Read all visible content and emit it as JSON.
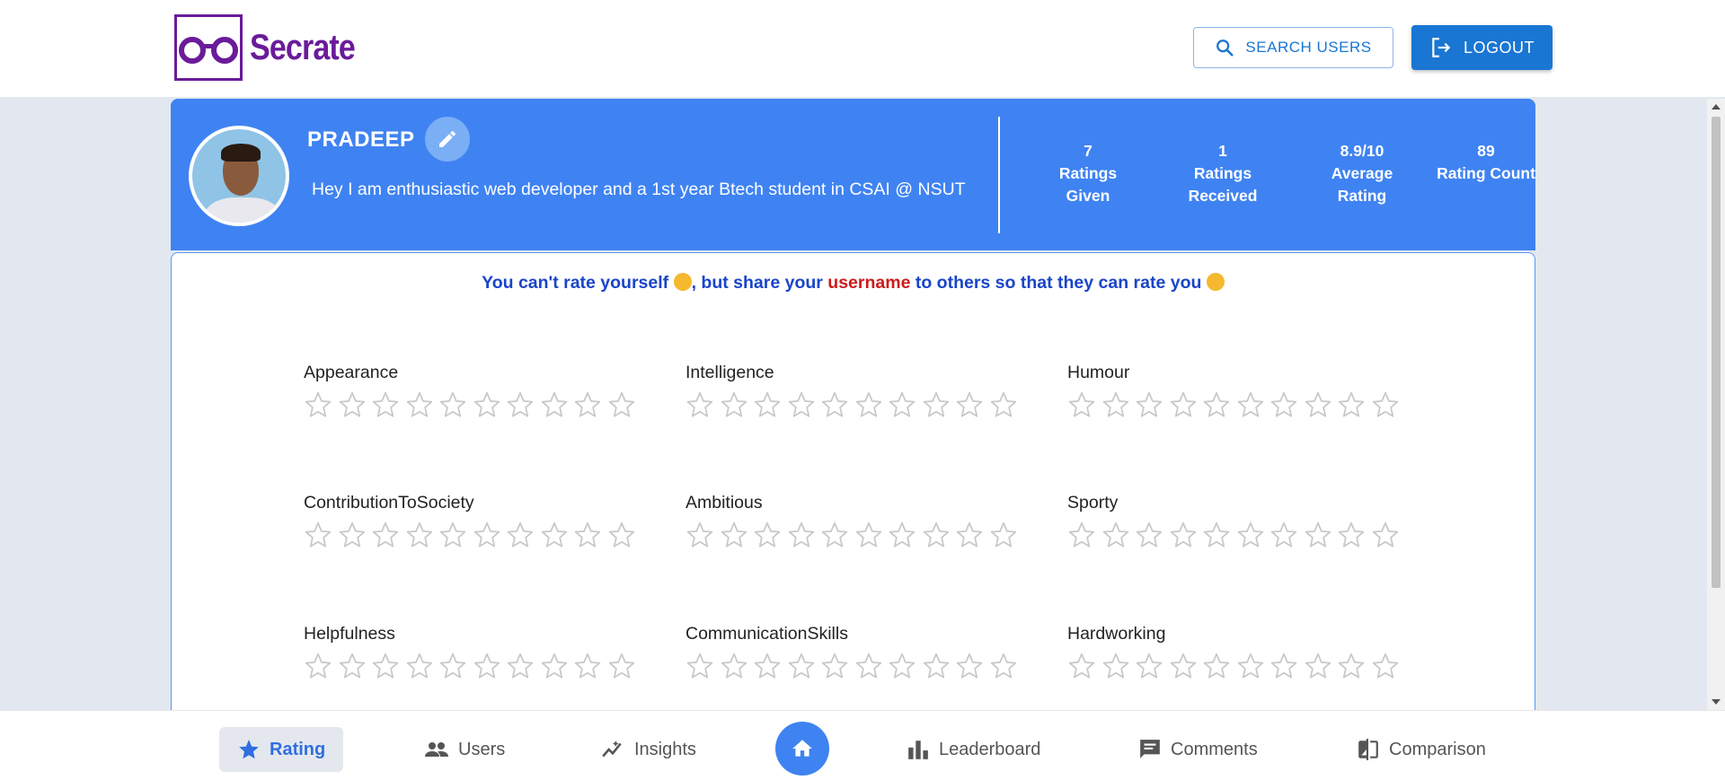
{
  "header": {
    "logo_text": "Secrate",
    "search_label": "SEARCH USERS",
    "logout_label": "LOGOUT"
  },
  "profile": {
    "name": "PRADEEP",
    "bio": "Hey I am enthusiastic web developer and a 1st year Btech student in CSAI @ NSUT",
    "stats": [
      {
        "value": "7",
        "label": "Ratings Given"
      },
      {
        "value": "1",
        "label": "Ratings Received"
      },
      {
        "value": "8.9/10",
        "label": "Average Rating"
      },
      {
        "value": "89",
        "label": "Rating Count"
      }
    ]
  },
  "notice": {
    "part1": "You can't rate yourself",
    "part2": ", but share your",
    "highlight": "username",
    "part3": "to others so that they can rate you"
  },
  "ratings": {
    "max_stars": 10,
    "items": [
      {
        "label": "Appearance",
        "value": 0
      },
      {
        "label": "Intelligence",
        "value": 0
      },
      {
        "label": "Humour",
        "value": 0
      },
      {
        "label": "ContributionToSociety",
        "value": 0
      },
      {
        "label": "Ambitious",
        "value": 0
      },
      {
        "label": "Sporty",
        "value": 0
      },
      {
        "label": "Helpfulness",
        "value": 0
      },
      {
        "label": "CommunicationSkills",
        "value": 0
      },
      {
        "label": "Hardworking",
        "value": 0
      }
    ]
  },
  "bottom_nav": {
    "rating": "Rating",
    "users": "Users",
    "insights": "Insights",
    "leaderboard": "Leaderboard",
    "comments": "Comments",
    "comparison": "Comparison"
  },
  "colors": {
    "brand": "#6a1b9a",
    "primary": "#1976d2",
    "header_bg": "#3f83f2",
    "notice_text": "#1a45c9",
    "notice_highlight": "#cc1b1b"
  }
}
